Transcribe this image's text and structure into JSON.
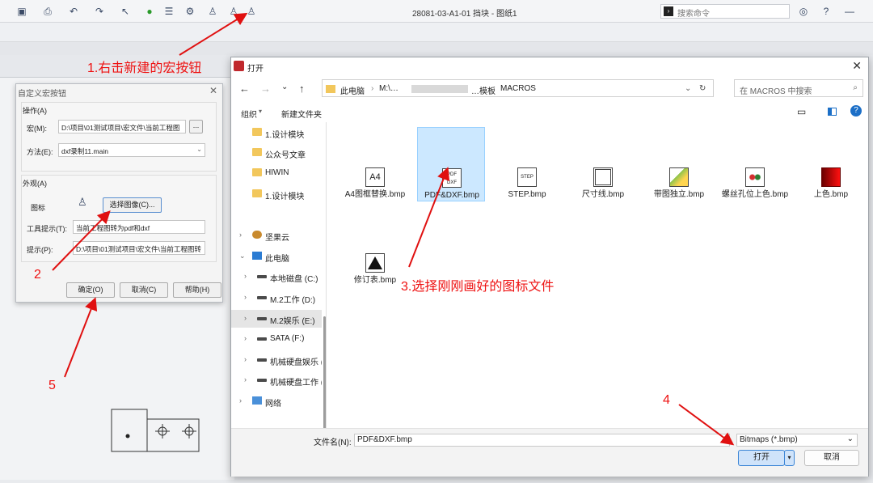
{
  "app": {
    "title": "28081-03-A1-01 挡块 - 图纸1",
    "search_placeholder": "搜索命令",
    "toolbar_icons": [
      "save-icon",
      "print-icon",
      "undo-icon",
      "redo-icon",
      "select-icon",
      "traffic-light-icon",
      "list-icon",
      "gear-icon",
      "macro-icon",
      "macro-icon",
      "macro-new-icon"
    ]
  },
  "macro_dialog": {
    "title": "自定义宏按钮",
    "operation_group": "操作(A)",
    "macro_label": "宏(M):",
    "macro_value": "D:\\项目\\01测试项目\\宏文件\\当前工程图",
    "browse_label": "...",
    "method_label": "方法(E):",
    "method_value": "dxf录制11.main",
    "appearance_group": "外观(A)",
    "icon_label": "图标",
    "choose_image_label": "选择图像(C)...",
    "tooltip_label": "工具提示(T):",
    "tooltip_value": "当前工程图转为pdf和dxf",
    "prompt_label": "提示(P):",
    "prompt_value": "D:\\项目\\01测试项目\\宏文件\\当前工程图转",
    "ok_label": "确定(O)",
    "cancel_label": "取消(C)",
    "help_label": "帮助(H)"
  },
  "open_dialog": {
    "title": "打开",
    "breadcrumb": [
      "此电脑",
      "M:\\…",
      "…模板",
      "MACROS"
    ],
    "search_placeholder": "在 MACROS 中搜索",
    "organize_label": "组织",
    "new_folder_label": "新建文件夹",
    "tree": [
      {
        "label": "1.设计模块",
        "kind": "folder"
      },
      {
        "label": "公众号文章",
        "kind": "folder"
      },
      {
        "label": "HIWIN",
        "kind": "folder"
      },
      {
        "label": "1.设计模块",
        "kind": "folder"
      },
      {
        "label": "坚果云",
        "kind": "cloud"
      },
      {
        "label": "此电脑",
        "kind": "pc"
      },
      {
        "label": "本地磁盘 (C:)",
        "kind": "drive"
      },
      {
        "label": "M.2工作 (D:)",
        "kind": "drive"
      },
      {
        "label": "M.2娱乐 (E:)",
        "kind": "drive"
      },
      {
        "label": "SATA (F:)",
        "kind": "drive"
      },
      {
        "label": "机械硬盘娱乐 (",
        "kind": "drive"
      },
      {
        "label": "机械硬盘工作 (",
        "kind": "drive"
      },
      {
        "label": "网络",
        "kind": "network"
      }
    ],
    "files": [
      {
        "name": "A4图框替换.bmp",
        "icon": "A4"
      },
      {
        "name": "PDF&DXF.bmp",
        "icon": "PDF DXF"
      },
      {
        "name": "STEP.bmp",
        "icon": "STEP"
      },
      {
        "name": "尺寸线.bmp",
        "icon": ""
      },
      {
        "name": "带图独立.bmp",
        "icon": ""
      },
      {
        "name": "螺丝孔位上色.bmp",
        "icon": ""
      },
      {
        "name": "上色.bmp",
        "icon": ""
      },
      {
        "name": "修订表.bmp",
        "icon": ""
      }
    ],
    "filename_label": "文件名(N):",
    "filename_value": "PDF&DXF.bmp",
    "filter_value": "Bitmaps (*.bmp)",
    "open_label": "打开",
    "cancel_label": "取消"
  },
  "annotations": {
    "step1": "1.右击新建的宏按钮",
    "step2": "2",
    "step3": "3.选择刚刚画好的图标文件",
    "step4": "4",
    "step5": "5"
  },
  "colors": {
    "annotation_red": "#e01010",
    "selection_blue": "#cce8ff",
    "primary_button": "#cfe3fa"
  }
}
